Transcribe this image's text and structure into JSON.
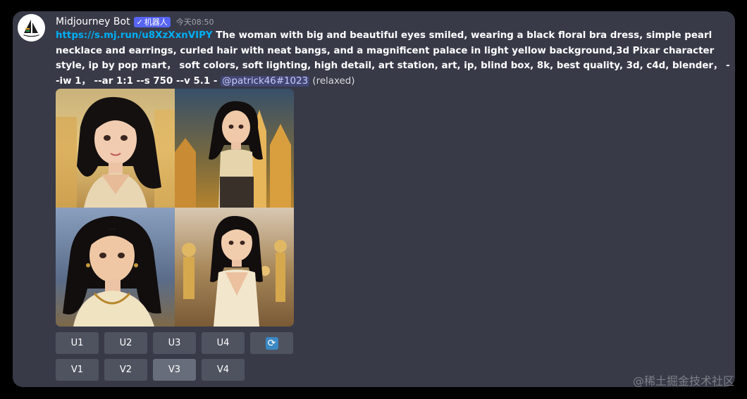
{
  "message": {
    "author": "Midjourney Bot",
    "bot_badge": "机器人",
    "verified_icon": "check-icon",
    "timestamp": "今天08:50",
    "link": "https://s.mj.run/u8XzXxnVIPY",
    "prompt": " The woman with big and beautiful eyes smiled, wearing a black floral bra dress, simple pearl necklace and earrings, curled hair with neat bangs, and a magnificent palace in light yellow background,3d Pixar character style, ip by pop mart， soft colors, soft lighting, high detail, art station, art, ip, blind box, 8k, best quality, 3d, c4d, blender， --iw 1， --ar 1:1 --s 750 --v 5.1 - ",
    "mention": "@patrick46#1023",
    "mode": " (relaxed)"
  },
  "buttons_row1": [
    {
      "label": "U1"
    },
    {
      "label": "U2"
    },
    {
      "label": "U3"
    },
    {
      "label": "U4"
    }
  ],
  "reroll_icon": "refresh-icon",
  "buttons_row2": [
    {
      "label": "V1"
    },
    {
      "label": "V2"
    },
    {
      "label": "V3",
      "active": true
    },
    {
      "label": "V4"
    }
  ],
  "watermark": "@稀土掘金技术社区",
  "colors": {
    "background": "#383a48",
    "link": "#00aff4",
    "button": "#4f5360",
    "badge": "#5865f2",
    "refresh": "#3b88c3"
  }
}
